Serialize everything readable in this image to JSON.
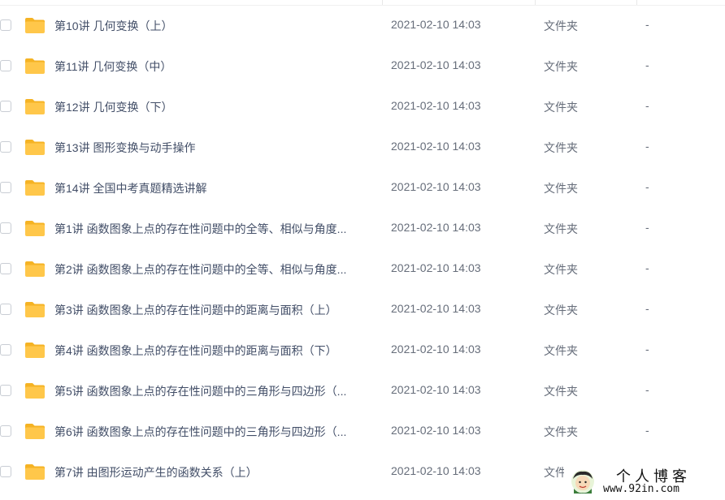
{
  "files": [
    {
      "name": "第10讲 几何变换（上）",
      "modified": "2021-02-10 14:03",
      "type": "文件夹",
      "size": "-"
    },
    {
      "name": "第11讲 几何变换（中）",
      "modified": "2021-02-10 14:03",
      "type": "文件夹",
      "size": "-"
    },
    {
      "name": "第12讲 几何变换（下）",
      "modified": "2021-02-10 14:03",
      "type": "文件夹",
      "size": "-"
    },
    {
      "name": "第13讲 图形变换与动手操作",
      "modified": "2021-02-10 14:03",
      "type": "文件夹",
      "size": "-"
    },
    {
      "name": "第14讲 全国中考真题精选讲解",
      "modified": "2021-02-10 14:03",
      "type": "文件夹",
      "size": "-"
    },
    {
      "name": "第1讲 函数图象上点的存在性问题中的全等、相似与角度...",
      "modified": "2021-02-10 14:03",
      "type": "文件夹",
      "size": "-"
    },
    {
      "name": "第2讲 函数图象上点的存在性问题中的全等、相似与角度...",
      "modified": "2021-02-10 14:03",
      "type": "文件夹",
      "size": "-"
    },
    {
      "name": "第3讲 函数图象上点的存在性问题中的距离与面积（上）",
      "modified": "2021-02-10 14:03",
      "type": "文件夹",
      "size": "-"
    },
    {
      "name": "第4讲 函数图象上点的存在性问题中的距离与面积（下）",
      "modified": "2021-02-10 14:03",
      "type": "文件夹",
      "size": "-"
    },
    {
      "name": "第5讲 函数图象上点的存在性问题中的三角形与四边形（...",
      "modified": "2021-02-10 14:03",
      "type": "文件夹",
      "size": "-"
    },
    {
      "name": "第6讲 函数图象上点的存在性问题中的三角形与四边形（...",
      "modified": "2021-02-10 14:03",
      "type": "文件夹",
      "size": "-"
    },
    {
      "name": "第7讲 由图形运动产生的函数关系（上）",
      "modified": "2021-02-10 14:03",
      "type": "文件",
      "size": ""
    }
  ],
  "icons": {
    "row_icon": "folder-icon"
  },
  "colors": {
    "folder": "#ffc74a",
    "folder_tab": "#f5b324",
    "text": "#424e67"
  },
  "watermark": {
    "title": "个人博客",
    "url": "www.92in.com"
  }
}
